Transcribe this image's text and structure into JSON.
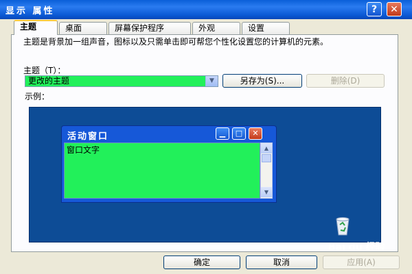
{
  "window": {
    "title": "显示 属性",
    "help_label": "?",
    "close_label": "✕"
  },
  "tabs": [
    {
      "label": "主题",
      "active": true
    },
    {
      "label": "桌面"
    },
    {
      "label": "屏幕保护程序"
    },
    {
      "label": "外观"
    },
    {
      "label": "设置"
    }
  ],
  "theme": {
    "description": "主题是背景加一组声音，图标以及只需单击即可帮您个性化设置您的计算机的元素。",
    "label": "主题（T）：",
    "selected": "更改的主题",
    "save_as_label": "另存为(S)...",
    "delete_label": "删除(D)"
  },
  "preview": {
    "label": "示例：",
    "window_title": "活动窗口",
    "window_text": "窗口文字",
    "icons": [
      "minimize-icon",
      "maximize-icon",
      "close-icon",
      "recycle-bin-icon"
    ]
  },
  "footer": {
    "ok_label": "确定",
    "cancel_label": "取消",
    "apply_label": "应用(A)"
  },
  "watermark": "Bai du 经验",
  "colors": {
    "title_bar": "#0a5fd8",
    "highlight_green": "#22f05a",
    "preview_desktop": "#0d4c96"
  }
}
